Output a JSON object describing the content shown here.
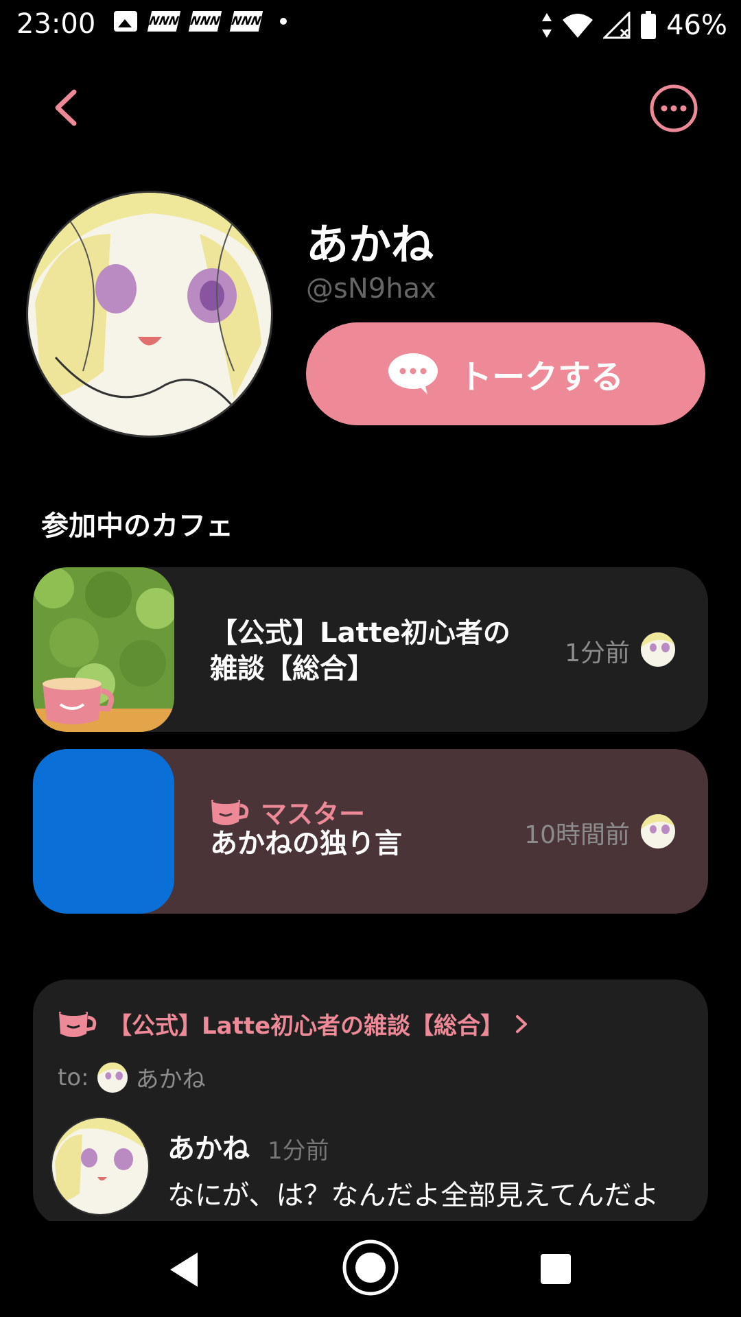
{
  "status_bar": {
    "time": "23:00",
    "notif_labels": [
      "NNN",
      "NNN",
      "NNN"
    ],
    "battery": "46%"
  },
  "profile": {
    "name": "あかね",
    "handle": "@sN9hax",
    "talk_button": "トークする"
  },
  "cafes_section": {
    "title": "参加中のカフェ",
    "items": [
      {
        "title_line1": "【公式】Latte初心者の",
        "title_line2": "雑談【総合】",
        "time": "1分前"
      },
      {
        "role": "マスター",
        "title": "あかねの独り言",
        "time": "10時間前"
      }
    ]
  },
  "post": {
    "cafe_name": "【公式】Latte初心者の雑談【総合】",
    "to_label": "to:",
    "to_name": "あかね",
    "author": "あかね",
    "time": "1分前",
    "body": "なにが、は？なんだよ全部見えてんだよ"
  },
  "colors": {
    "accent": "#ee8a98",
    "row_dark": "#1f1f1f",
    "row_master": "#4a3437",
    "thumb_blue": "#0a6fd6"
  }
}
